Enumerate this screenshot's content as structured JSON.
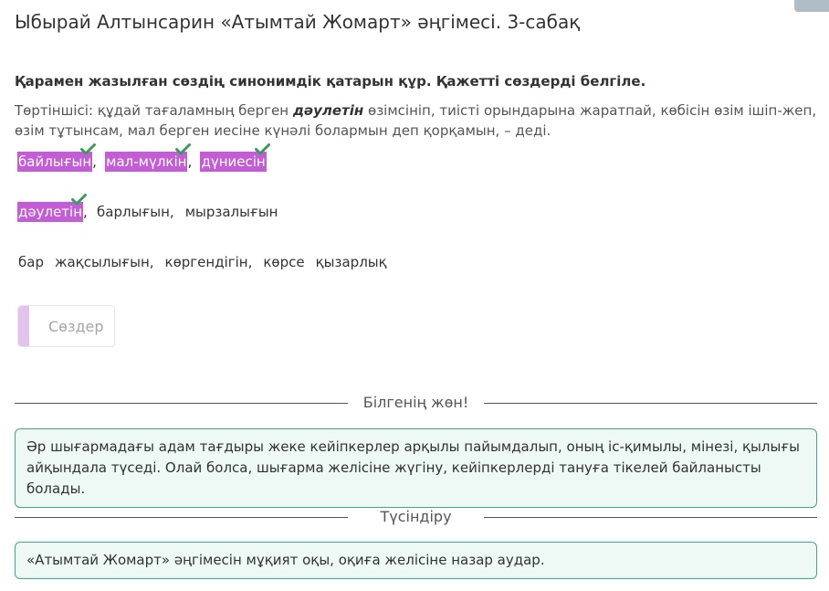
{
  "title": "Ыбырай Алтынсарин «Атымтай Жомарт» әңгімесі. 3-сабақ",
  "question": "Қарамен жазылған сөздің синонимдік қатарын құр. Қажетті сөздерді белгіле.",
  "sentence": {
    "before": "Төртіншісі: құдай тағаламның берген ",
    "bold": "дәулетін",
    "after": " өзімсініп, тиісті орындарына жаратпай, көбісін өзім ішіп-жеп, өзім тұтынсам, мал берген иесіне күнәлі болармын деп қорқамын, – деді."
  },
  "rows": [
    {
      "words": [
        {
          "text": "байлығын",
          "selected": true,
          "sep": ","
        },
        {
          "text": "мал-мүлкін",
          "selected": true,
          "sep": ","
        },
        {
          "text": "дүниесін",
          "selected": true,
          "sep": ""
        }
      ]
    },
    {
      "words": [
        {
          "text": "дәулетін",
          "selected": true,
          "sep": ","
        },
        {
          "text": "барлығын,",
          "selected": false,
          "sep": ""
        },
        {
          "text": "мырзалығын",
          "selected": false,
          "sep": ""
        }
      ]
    },
    {
      "words": [
        {
          "text": "бар",
          "selected": false,
          "sep": ""
        },
        {
          "text": "жақсылығын,",
          "selected": false,
          "sep": ""
        },
        {
          "text": "көргендігін,",
          "selected": false,
          "sep": ""
        },
        {
          "text": "көрсе",
          "selected": false,
          "sep": ""
        },
        {
          "text": "қызарлық",
          "selected": false,
          "sep": ""
        }
      ]
    }
  ],
  "words_box_label": "Сөздер",
  "hint": {
    "header": "Білгенің жөн!",
    "text": "Әр шығармадағы адам тағдыры жеке кейіпкерлер арқылы пайымдалып, оның іс-қимылы, мінезі, қылығы айқындала түседі. Олай болса, шығарма желісіне жүгіну, кейіпкерлерді тануға тікелей байланысты болады."
  },
  "explanation": {
    "header": "Түсіндіру",
    "text": "«Атымтай Жомарт» әңгімесін мұқият оқы, оқиға желісіне назар аудар."
  },
  "colors": {
    "selected": "#c35dd6",
    "check": "#3a9a5a",
    "box_border": "#3fa88c",
    "box_bg": "#eef8f4"
  }
}
